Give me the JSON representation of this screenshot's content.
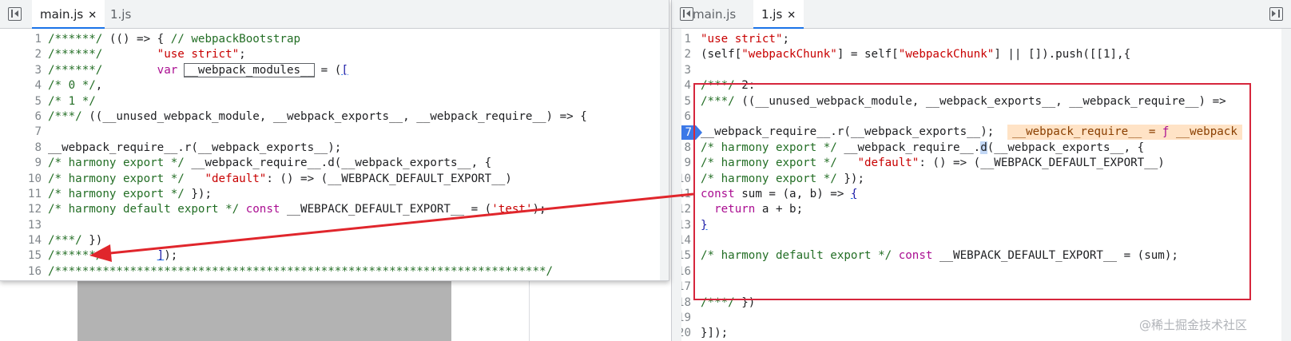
{
  "left_panel": {
    "tabs": [
      {
        "label": "main.js",
        "close": "✕"
      },
      {
        "label": "1.js"
      }
    ]
  },
  "right_panel": {
    "tabs": [
      {
        "label": "main.js"
      },
      {
        "label": "1.js",
        "close": "✕"
      }
    ],
    "inline_value": {
      "name": "__webpack_require__",
      "eq": " = ",
      "kw": "ƒ",
      "rest": " __webpack"
    }
  },
  "watermark": "@稀土掘金技术社区",
  "colors": {
    "highlight_box": "#d6263c",
    "arrow": "#e0262c",
    "breakpoint": "#3b78e7"
  }
}
